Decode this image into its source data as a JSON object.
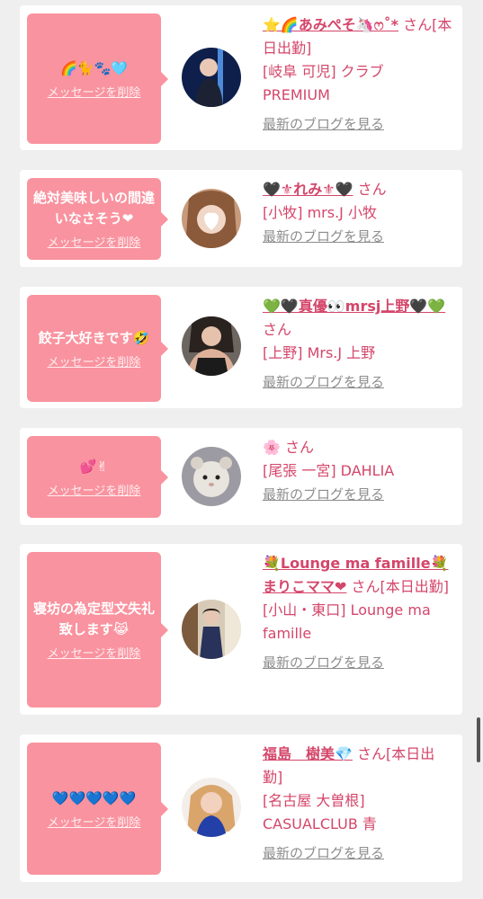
{
  "delete_label": "メッセージを削除",
  "blog_label": "最新のブログを見る",
  "san": "さん",
  "colors": {
    "bubble": "#f9939f",
    "name": "#d4466a",
    "link": "#8d8d8d",
    "background": "#efefef"
  },
  "cards": [
    {
      "message": "🌈🐈🐾🩵",
      "name": "⭐🌈あみぺそ🦄ෆ˚*",
      "suffix": "[本日出勤]",
      "shop": "[岐阜 可児] クラブ PREMIUM",
      "avatar_icon": "profile-photo"
    },
    {
      "message": "絶対美味しいの間違いなさそう❤",
      "name": "🖤⚜れみ⚜🖤",
      "suffix": "",
      "shop": "[小牧] mrs.J 小牧",
      "avatar_icon": "profile-photo"
    },
    {
      "message": "餃子大好きです🤣",
      "name": "💚🖤真優👀mrsj上野🖤💚",
      "suffix": "",
      "shop": "[上野] Mrs.J 上野",
      "avatar_icon": "profile-photo"
    },
    {
      "message": "💕✌",
      "name": "🌸",
      "suffix": "",
      "shop": "[尾張 一宮] DAHLIA",
      "avatar_icon": "profile-photo"
    },
    {
      "message": "寝坊の為定型文失礼致します😹",
      "name": "💐Lounge ma famille💐まりこママ❤",
      "suffix": "[本日出勤]",
      "shop": "[小山・東口] Lounge ma famille",
      "avatar_icon": "profile-photo"
    },
    {
      "message": "💙💙💙💙💙",
      "name": "福島　樹美💎",
      "suffix": "[本日出勤]",
      "shop": "[名古屋 大曽根] CASUALCLUB 青",
      "avatar_icon": "profile-photo"
    }
  ]
}
